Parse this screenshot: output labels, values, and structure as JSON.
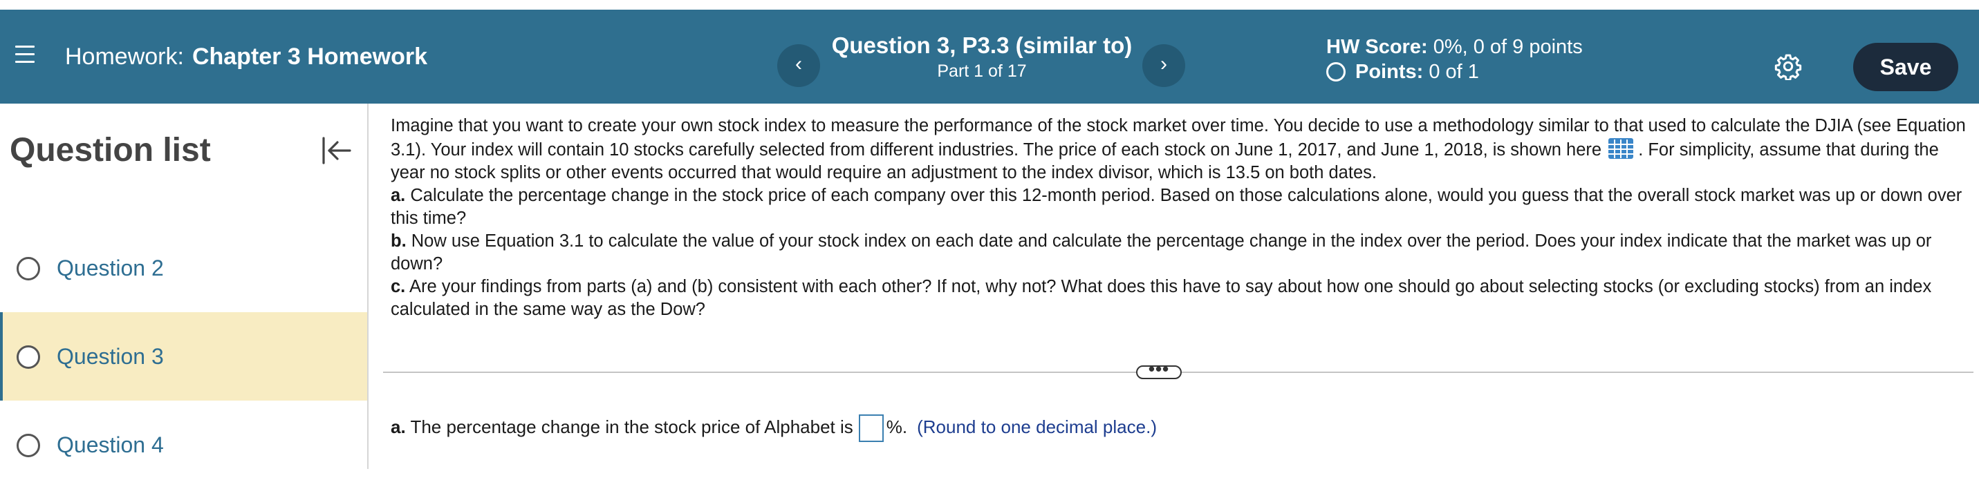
{
  "header": {
    "homework_label": "Homework:",
    "homework_title": "Chapter 3 Homework",
    "question_title": "Question 3, P3.3 (similar to)",
    "part_text": "Part 1 of 17",
    "prev_glyph": "‹",
    "next_glyph": "›",
    "score_label": "HW Score:",
    "score_value": "0%, 0 of 9 points",
    "points_label": "Points:",
    "points_value": "0 of 1",
    "save_label": "Save",
    "bar_color": "#2f6f8f",
    "save_color": "#1c2b3c"
  },
  "sidebar": {
    "title": "Question list",
    "items": [
      {
        "label": "Question 2"
      },
      {
        "label": "Question 3",
        "active": true
      },
      {
        "label": "Question 4"
      }
    ],
    "active_color": "#f8ecc2"
  },
  "question": {
    "intro_1": "Imagine that you want to create your own stock index to measure the performance of the stock market over time. You decide to use a methodology similar to that used to calculate the DJIA (see Equation 3.1). Your index will contain 10 stocks carefully selected from different industries. The price of each stock on June 1, 2017, and June 1, 2018, is shown here",
    "intro_2": ". For simplicity, assume that during the year no stock splits or other events occurred that would require an adjustment to the index divisor, which is 13.5 on both dates.",
    "part_a_label": "a.",
    "part_a": "Calculate the percentage change in the stock price of each company over this 12-month period. Based on those calculations alone, would you guess that the overall stock market was up or down over this time?",
    "part_b_label": "b.",
    "part_b": "Now use Equation 3.1 to calculate the value of your stock index on each date and calculate the percentage change in the index over the period. Does your index indicate that the market was up or down?",
    "part_c_label": "c.",
    "part_c": "Are your findings from parts (a) and (b) consistent with each other? If not, why not? What does this have to say about how one should go about selecting stocks (or excluding stocks) from an index calculated in the same way as the Dow?"
  },
  "divider": {
    "handle_glyph": "•••"
  },
  "answer": {
    "label": "a.",
    "text_before": "The percentage change in the stock price of Alphabet is",
    "input_value": "",
    "text_after": "%.",
    "hint": "(Round to one decimal place.)"
  },
  "icons": {
    "menu": "hamburger-menu-icon",
    "settings": "gear-icon",
    "collapse": "collapse-left-icon",
    "data_table": "data-table-icon"
  }
}
